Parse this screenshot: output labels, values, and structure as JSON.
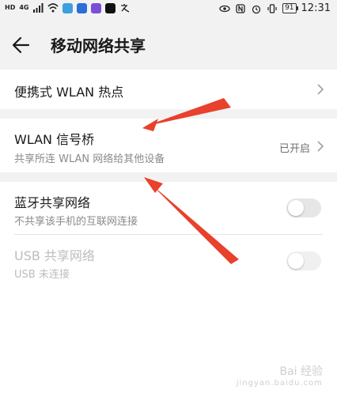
{
  "status_bar": {
    "chip_hd": "HD",
    "chip_4g": "4G",
    "battery": "91",
    "time": "12:31"
  },
  "header": {
    "title": "移动网络共享"
  },
  "settings": {
    "hotspot": {
      "title": "便携式 WLAN 热点"
    },
    "bridge": {
      "title": "WLAN 信号桥",
      "subtitle": "共享所连 WLAN 网络给其他设备",
      "status": "已开启"
    },
    "bluetooth": {
      "title": "蓝牙共享网络",
      "subtitle": "不共享该手机的互联网连接",
      "toggle_on": false
    },
    "usb": {
      "title": "USB 共享网络",
      "subtitle": "USB 未连接",
      "toggle_on": false,
      "enabled": false
    }
  },
  "watermark": {
    "brand": "Bai 经验",
    "url": "jingyan.baidu.com"
  },
  "colors": {
    "background": "#f2f2f2",
    "annotation_arrow": "#e8412c",
    "secondary_text": "#8a8a8a"
  }
}
